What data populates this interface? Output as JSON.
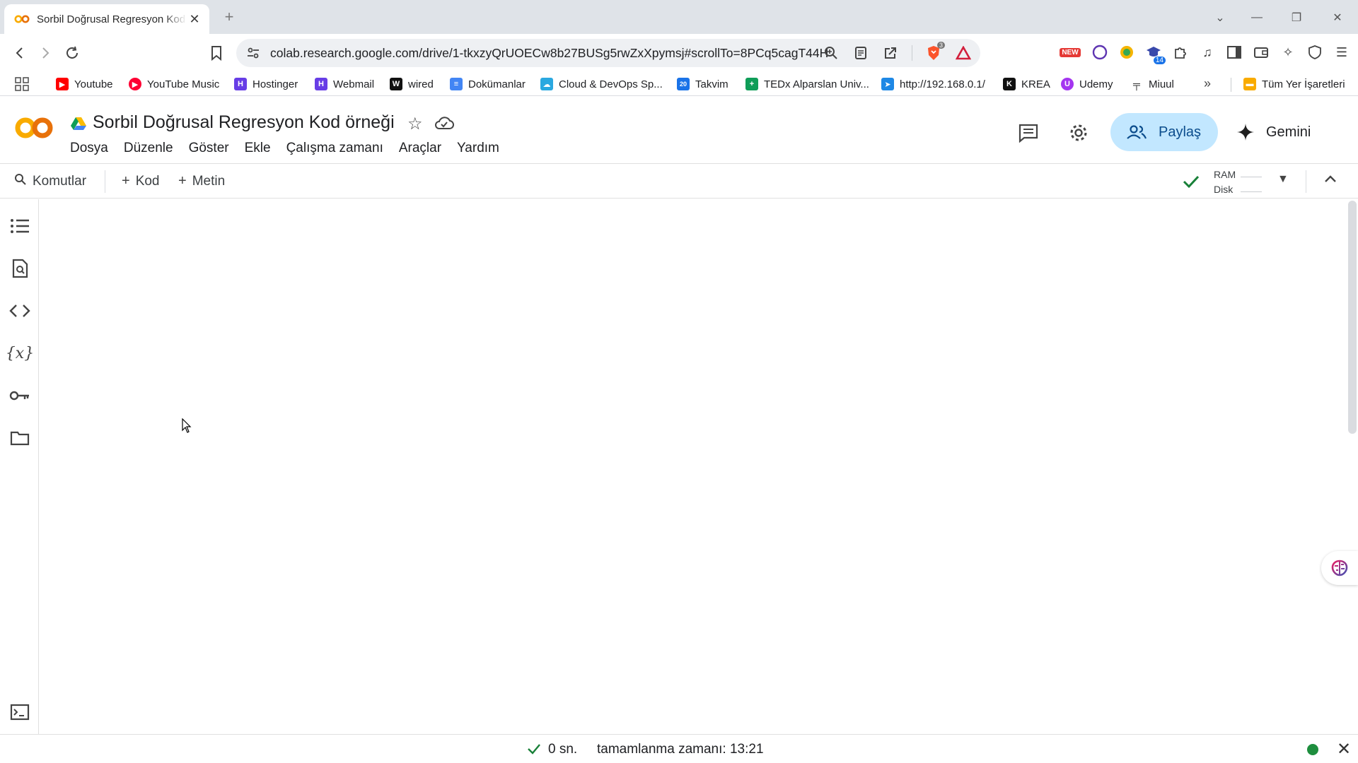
{
  "browser": {
    "tab": {
      "title": "Sorbil Doğrusal Regresyon Kod örneği - Colaboratory"
    },
    "address_bar": {
      "url": "colab.research.google.com/drive/1-tkxzyQrUOECw8b27BUSg5rwZxXpymsj#scrollTo=8PCq5cagT44H"
    },
    "extensions": {
      "new_badge": "NEW",
      "count_badge": "14",
      "shield_badge": "3"
    },
    "bookmarks": [
      {
        "label": "Youtube",
        "icon": "youtube-icon",
        "color": "#ff0000"
      },
      {
        "label": "YouTube Music",
        "icon": "youtube-music-icon",
        "color": "#ff0033"
      },
      {
        "label": "Hostinger",
        "icon": "hostinger-icon",
        "color": "#673de6"
      },
      {
        "label": "Webmail",
        "icon": "hostinger-icon",
        "color": "#673de6"
      },
      {
        "label": "wired",
        "icon": "wired-icon",
        "color": "#111111"
      },
      {
        "label": "Dokümanlar",
        "icon": "docs-icon",
        "color": "#4285f4"
      },
      {
        "label": "Cloud & DevOps Sp...",
        "icon": "cloud-icon",
        "color": "#2aa8e0"
      },
      {
        "label": "Takvim",
        "icon": "calendar-icon",
        "color": "#1a73e8"
      },
      {
        "label": "TEDx Alparslan Univ...",
        "icon": "sheets-icon",
        "color": "#0f9d58"
      },
      {
        "label": "http://192.168.0.1/",
        "icon": "router-icon",
        "color": "#1e88e5"
      },
      {
        "label": "KREA",
        "icon": "krea-icon",
        "color": "#111111"
      },
      {
        "label": "Udemy",
        "icon": "udemy-icon",
        "color": "#a435f0"
      },
      {
        "label": "Miuul",
        "icon": "miuul-icon",
        "color": "#333333"
      }
    ],
    "all_bookmarks": "Tüm Yer İşaretleri"
  },
  "colab": {
    "title": "Sorbil Doğrusal Regresyon Kod örneği",
    "menu": [
      "Dosya",
      "Düzenle",
      "Göster",
      "Ekle",
      "Çalışma zamanı",
      "Araçlar",
      "Yardım"
    ],
    "share_label": "Paylaş",
    "gemini_label": "Gemini",
    "toolbar": {
      "commands_label": "Komutlar",
      "add_code_label": "Kod",
      "add_text_label": "Metin",
      "ram_label": "RAM",
      "disk_label": "Disk"
    },
    "status": {
      "duration": "0 sn.",
      "completed": "tamamlanma zamanı: 13:21"
    },
    "colors": {
      "accent": "#c2e7ff",
      "ok_green": "#188038"
    }
  }
}
